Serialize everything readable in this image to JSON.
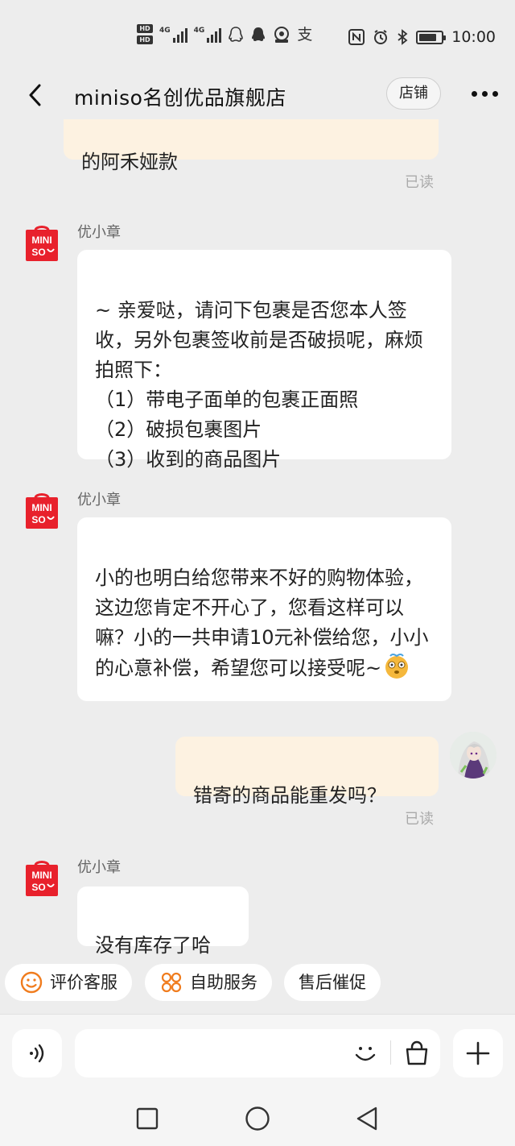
{
  "status_bar": {
    "hd1": "HD 1",
    "hd2": "HD 2",
    "net1": "4G",
    "net2": "4G",
    "time": "10:00",
    "icons": [
      "hd-icon",
      "signal-icon",
      "qq-icon",
      "browser-icon",
      "alipay-icon",
      "nfc-icon",
      "alarm-icon",
      "bluetooth-icon",
      "battery-icon"
    ]
  },
  "header": {
    "title": "miniso名创优品旗舰店",
    "shop_button": "店铺"
  },
  "chat": {
    "partial_bubble_text": "的阿禾娅款",
    "read_label_1": "已读",
    "sender_1": "优小章",
    "message_1": "~ 亲爱哒，请问下包裹是否您本人签收，另外包裹签收前是否破损呢，麻烦拍照下：\n（1）带电子面单的包裹正面照\n（2）破损包裹图片\n（3）收到的商品图片",
    "sender_2": "优小章",
    "message_2": "小的也明白给您带来不好的购物体验，这边您肯定不开心了，您看这样可以嘛？小的一共申请10元补偿给您，小小的心意补偿，希望您可以接受呢~",
    "my_message": "错寄的商品能重发吗？",
    "read_label_2": "已读",
    "sender_3": "优小章",
    "message_3": "没有库存了哈",
    "logo_text_top": "MINI",
    "logo_text_bottom": "SO"
  },
  "quick_actions": [
    {
      "label": "评价客服",
      "icon": "smile-icon"
    },
    {
      "label": "自助服务",
      "icon": "grid-icon"
    },
    {
      "label": "售后催促",
      "icon": ""
    }
  ],
  "input_bar": {
    "placeholder": "",
    "icons": [
      "voice-icon",
      "emoji-icon",
      "bag-icon",
      "plus-icon"
    ]
  },
  "nav_bar": {
    "icons": [
      "recent-apps-icon",
      "home-icon",
      "back-icon"
    ]
  },
  "colors": {
    "background": "#ededed",
    "bubble_other": "#ffffff",
    "bubble_mine": "#fdf2e1",
    "brand_red": "#e8212c",
    "quick_icon_orange": "#f07c1e"
  }
}
